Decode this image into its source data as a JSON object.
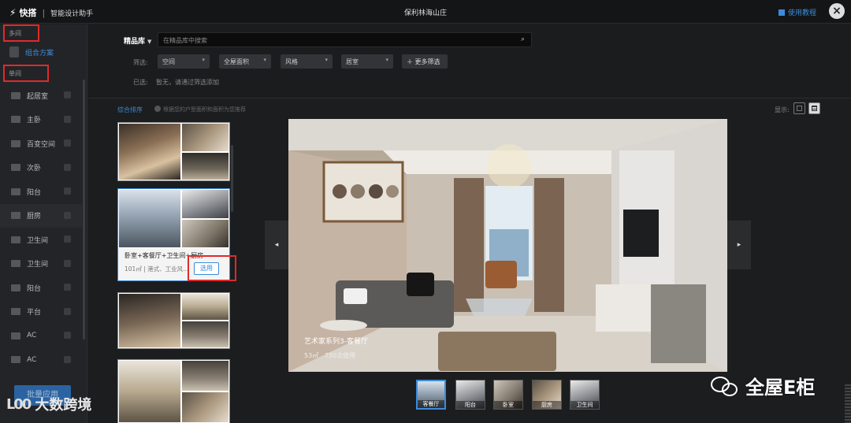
{
  "topbar": {
    "logo_name": "快搭",
    "logo_sub": "智能设计助手",
    "project_title": "保利林海山庄",
    "tutorial_label": "使用教程",
    "close_glyph": "×"
  },
  "sidebar": {
    "section_1": "多间",
    "combo_label": "组合方案",
    "section_2": "单间",
    "rooms": [
      {
        "label": "起居室",
        "icon": "sofa-icon"
      },
      {
        "label": "主卧",
        "icon": "bed-icon"
      },
      {
        "label": "百变空间",
        "icon": "multi-room-icon"
      },
      {
        "label": "次卧",
        "icon": "bed-icon"
      },
      {
        "label": "阳台",
        "icon": "balcony-icon"
      },
      {
        "label": "厨房",
        "icon": "kitchen-icon"
      },
      {
        "label": "卫生间",
        "icon": "toilet-icon"
      },
      {
        "label": "卫生间",
        "icon": "toilet-icon"
      },
      {
        "label": "阳台",
        "icon": "balcony-icon"
      },
      {
        "label": "平台",
        "icon": "platform-icon"
      },
      {
        "label": "AC",
        "icon": "ac-icon"
      },
      {
        "label": "AC",
        "icon": "ac-icon"
      }
    ],
    "batch_button": "批量应用"
  },
  "filters": {
    "library_label": "精品库",
    "search_placeholder": "在精品库中搜索",
    "filter_label": "筛选:",
    "dropdowns": [
      "空间",
      "全屋面积",
      "风格",
      "居室"
    ],
    "more_filters": "更多筛选",
    "selected_label": "已选:",
    "selected_none": "暂无，请通过筛选添加"
  },
  "content": {
    "sort_label": "综合排序",
    "hint": "根据您的户型面积和面积为您推荐",
    "display_label": "显示:"
  },
  "cards": [
    {
      "name": "",
      "meta": ""
    },
    {
      "name": "卧室+客餐厅+卫生间+厨房",
      "meta": "101㎡ | 港式、工业风...",
      "use_button": "选用"
    },
    {
      "name": "",
      "meta": ""
    },
    {
      "name": "",
      "meta": ""
    }
  ],
  "preview": {
    "caption": "艺术家系列3-客餐厅",
    "area": "53㎡",
    "uses": "730次使用"
  },
  "thumbnails": [
    "客餐厅",
    "阳台",
    "卧室",
    "厨房",
    "卫生间"
  ],
  "watermarks": {
    "right": "全屋E柜",
    "left": "大数跨境"
  },
  "colors": {
    "accent": "#3b8bdb",
    "highlight_red": "#e02a2a",
    "background": "#1c1d1f"
  }
}
